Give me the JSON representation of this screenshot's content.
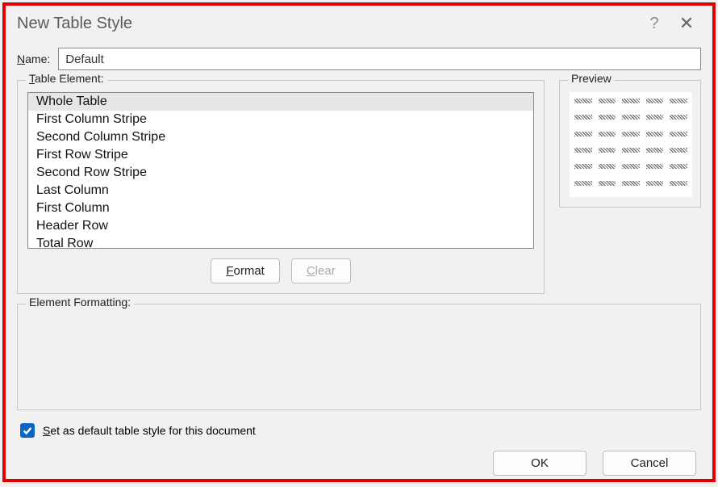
{
  "dialog": {
    "title": "New Table Style",
    "help": "?",
    "close": "✕"
  },
  "name": {
    "label_pre": "N",
    "label_post": "ame:",
    "value": "Default"
  },
  "table_element": {
    "label_pre": "T",
    "label_post": "able Element:",
    "items": [
      "Whole Table",
      "First Column Stripe",
      "Second Column Stripe",
      "First Row Stripe",
      "Second Row Stripe",
      "Last Column",
      "First Column",
      "Header Row",
      "Total Row"
    ],
    "selected_index": 0
  },
  "buttons": {
    "format_pre": "F",
    "format_post": "ormat",
    "clear_pre": "C",
    "clear_post": "lear"
  },
  "preview": {
    "label": "Preview",
    "rows": 6,
    "cols": 5
  },
  "element_formatting": {
    "label": "Element Formatting:"
  },
  "checkbox": {
    "checked": true,
    "label_pre": "S",
    "label_post": "et as default table style for this document"
  },
  "footer": {
    "ok": "OK",
    "cancel": "Cancel"
  }
}
